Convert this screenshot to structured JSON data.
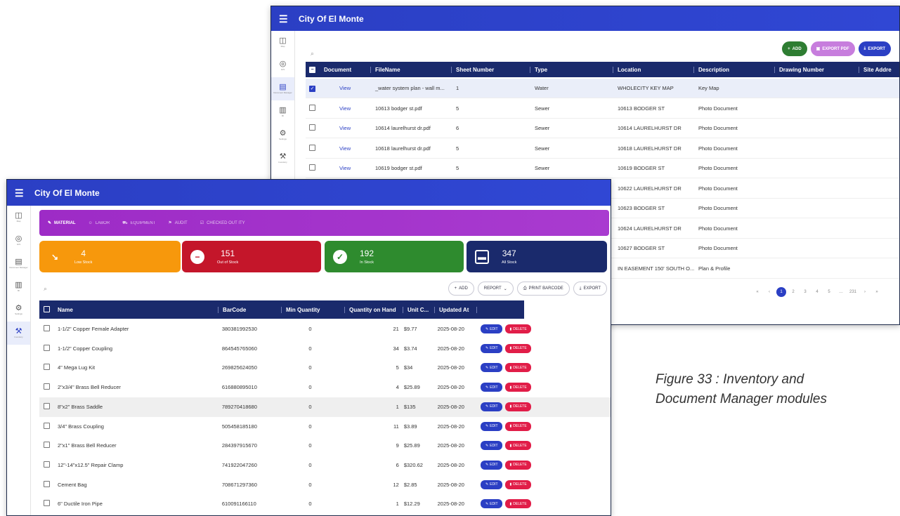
{
  "doc_window": {
    "title": "City Of El Monte",
    "rail": [
      {
        "icon": "map-icon",
        "label": "Map"
      },
      {
        "icon": "gis-icon",
        "label": "GIS"
      },
      {
        "icon": "document-icon",
        "label": "Document Manager"
      },
      {
        "icon": "chart-icon",
        "label": "BI"
      },
      {
        "icon": "settings-icon",
        "label": "Settings"
      },
      {
        "icon": "inventory-icon",
        "label": "Inventory"
      }
    ],
    "buttons": {
      "add": "ADD",
      "export_pdf": "EXPORT PDF",
      "export": "EXPORT"
    },
    "columns": [
      "Document",
      "FileName",
      "Sheet Number",
      "Type",
      "Location",
      "Description",
      "Drawing Number",
      "Site Addre"
    ],
    "rows": [
      {
        "checked": true,
        "doc": "View",
        "file": "_water system plan - wall m...",
        "sheet": "1",
        "type": "Water",
        "location": "WHOLECITY KEY MAP",
        "desc": "Key Map"
      },
      {
        "checked": false,
        "doc": "View",
        "file": "10613 bodger st.pdf",
        "sheet": "5",
        "type": "Sewer",
        "location": "10613 BODGER ST",
        "desc": "Photo Document"
      },
      {
        "checked": false,
        "doc": "View",
        "file": "10614 laurelhurst dr.pdf",
        "sheet": "6",
        "type": "Sewer",
        "location": "10614 LAURELHURST DR",
        "desc": "Photo Document"
      },
      {
        "checked": false,
        "doc": "View",
        "file": "10618 laurelhurst dr.pdf",
        "sheet": "5",
        "type": "Sewer",
        "location": "10618 LAURELHURST DR",
        "desc": "Photo Document"
      },
      {
        "checked": false,
        "doc": "View",
        "file": "10619 bodger st.pdf",
        "sheet": "5",
        "type": "Sewer",
        "location": "10619 BODGER ST",
        "desc": "Photo Document"
      },
      {
        "checked": false,
        "doc": "",
        "file": "",
        "sheet": "",
        "type": "",
        "location": "10622 LAURELHURST DR",
        "desc": "Photo Document"
      },
      {
        "checked": false,
        "doc": "",
        "file": "",
        "sheet": "",
        "type": "",
        "location": "10623 BODGER ST",
        "desc": "Photo Document"
      },
      {
        "checked": false,
        "doc": "",
        "file": "",
        "sheet": "",
        "type": "",
        "location": "10624 LAURELHURST DR",
        "desc": "Photo Document"
      },
      {
        "checked": false,
        "doc": "",
        "file": "",
        "sheet": "",
        "type": "",
        "location": "10627 BODGER ST",
        "desc": "Photo Document"
      },
      {
        "checked": false,
        "doc": "",
        "file": "",
        "sheet": "",
        "type": "",
        "location": "IN EASEMENT 150' SOUTH O...",
        "desc": "Plan & Profile"
      }
    ],
    "pagination": {
      "current": "1",
      "pages": [
        "2",
        "3",
        "4",
        "5"
      ],
      "last": "231",
      "next": "›",
      "end": "»"
    }
  },
  "inv_window": {
    "title": "City Of El Monte",
    "tabs": [
      "MATERIAL",
      "LABOR",
      "EQUIPMENT",
      "AUDIT",
      "CHECKED OUT ITY"
    ],
    "cards": [
      {
        "value": "4",
        "label": "Low Stock",
        "color": "#f7980c",
        "icon": "trend-down-icon"
      },
      {
        "value": "151",
        "label": "Out of Stock",
        "color": "#c4162a",
        "icon": "minus-circle-icon"
      },
      {
        "value": "192",
        "label": "In Stock",
        "color": "#2e8b2e",
        "icon": "check-circle-icon"
      },
      {
        "value": "347",
        "label": "All Stock",
        "color": "#1a2a6c",
        "icon": "archive-icon"
      }
    ],
    "buttons": {
      "add": "ADD",
      "report": "REPORT",
      "print": "PRINT BARCODE",
      "export": "EXPORT"
    },
    "columns": [
      "Name",
      "BarCode",
      "Min Quantity",
      "Quantity on Hand",
      "Unit C...",
      "Updated At"
    ],
    "edit_label": "EDIT",
    "delete_label": "DELETE",
    "rows": [
      {
        "name": "1-1/2\" Copper Female Adapter",
        "barcode": "380381992530",
        "min": "0",
        "qty": "21",
        "cost": "$9.77",
        "updated": "2025-08-20"
      },
      {
        "name": "1-1/2\" Copper Coupling",
        "barcode": "864545765060",
        "min": "0",
        "qty": "34",
        "cost": "$3.74",
        "updated": "2025-08-20"
      },
      {
        "name": "4\" Mega Lug Kit",
        "barcode": "269825624050",
        "min": "0",
        "qty": "5",
        "cost": "$34",
        "updated": "2025-08-20"
      },
      {
        "name": "2\"x3/4\" Brass Bell Reducer",
        "barcode": "616880895010",
        "min": "0",
        "qty": "4",
        "cost": "$25.89",
        "updated": "2025-08-20"
      },
      {
        "name": "8\"x2\" Brass Saddle",
        "barcode": "789270418680",
        "min": "0",
        "qty": "1",
        "cost": "$135",
        "updated": "2025-08-20"
      },
      {
        "name": "3/4\" Brass Coupling",
        "barcode": "505458185180",
        "min": "0",
        "qty": "11",
        "cost": "$3.89",
        "updated": "2025-08-20"
      },
      {
        "name": "2\"x1\" Brass Bell Reducer",
        "barcode": "284397915670",
        "min": "0",
        "qty": "9",
        "cost": "$25.89",
        "updated": "2025-08-20"
      },
      {
        "name": "12\"-14\"x12.5\" Repair Clamp",
        "barcode": "741922047260",
        "min": "0",
        "qty": "6",
        "cost": "$320.62",
        "updated": "2025-08-20"
      },
      {
        "name": "Cement Bag",
        "barcode": "708671297360",
        "min": "0",
        "qty": "12",
        "cost": "$2.85",
        "updated": "2025-08-20"
      },
      {
        "name": "6\" Ductile Iron Pipe",
        "barcode": "610091166110",
        "min": "0",
        "qty": "1",
        "cost": "$12.29",
        "updated": "2025-08-20"
      }
    ]
  },
  "caption": "Figure 33 : Inventory and Document Manager modules"
}
